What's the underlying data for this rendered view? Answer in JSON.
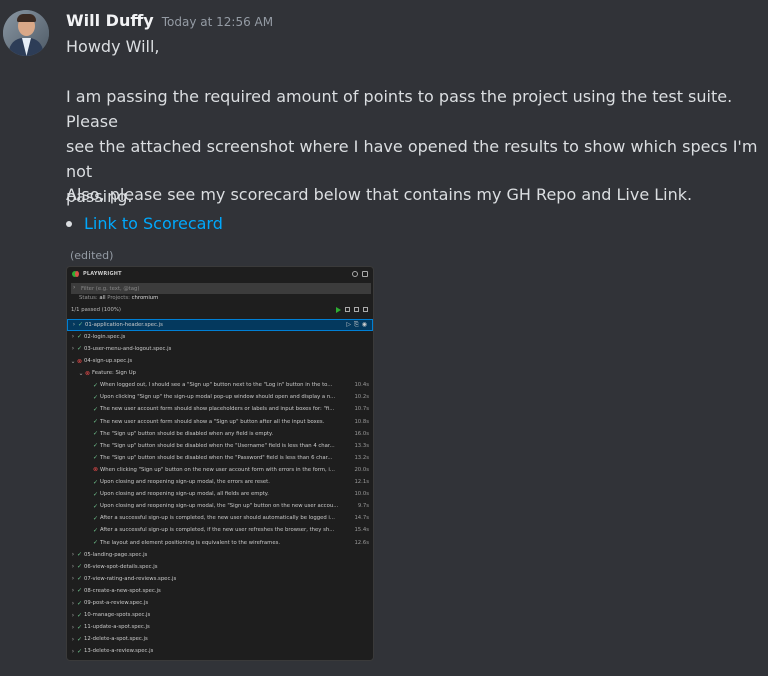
{
  "message": {
    "author": "Will Duffy",
    "timestamp": "Today at 12:56 AM",
    "greeting": "Howdy Will,",
    "paragraph1_line1": "I am passing the required amount of points to pass the project using  the test suite.  Please",
    "paragraph1_line2": "see the attached screenshot where I have opened the results to show which specs I'm not",
    "paragraph1_line3": "passing.",
    "paragraph2": "Also, please see my scorecard below that contains my GH Repo and Live Link.",
    "link_text": "Link to Scorecard",
    "edited_label": "(edited)"
  },
  "attachment": {
    "panel_title": "PLAYWRIGHT",
    "filter_placeholder": "Filter (e.g. text, @tag)",
    "status_label": "Status:",
    "status_value": "all",
    "projects_label": "Projects:",
    "projects_value": "chromium",
    "summary": "1/1 passed (100%)",
    "rows": [
      {
        "indent": 0,
        "chevron": ">",
        "status": "pass",
        "text": "01-application-header.spec.js",
        "duration": "",
        "selected": true
      },
      {
        "indent": 0,
        "chevron": ">",
        "status": "pass",
        "text": "02-login.spec.js",
        "duration": ""
      },
      {
        "indent": 0,
        "chevron": ">",
        "status": "pass",
        "text": "03-user-menu-and-logout.spec.js",
        "duration": ""
      },
      {
        "indent": 0,
        "chevron": "v",
        "status": "fail",
        "text": "04-sign-up.spec.js",
        "duration": ""
      },
      {
        "indent": 1,
        "chevron": "v",
        "status": "fail",
        "text": "Feature: Sign Up",
        "duration": ""
      },
      {
        "indent": 2,
        "chevron": "",
        "status": "pass",
        "text": "When logged out, I should see a \"Sign up\" button next to the \"Log in\" button in the to...",
        "duration": "10.4s"
      },
      {
        "indent": 2,
        "chevron": "",
        "status": "pass",
        "text": "Upon clicking \"Sign up\" the sign-up modal pop-up window should open and display a n...",
        "duration": "10.2s"
      },
      {
        "indent": 2,
        "chevron": "",
        "status": "pass",
        "text": "The new user account form should show placeholders or labels and input boxes for: \"fi...",
        "duration": "10.7s"
      },
      {
        "indent": 2,
        "chevron": "",
        "status": "pass",
        "text": "The new user account form should show a \"Sign up\" button after all the input boxes.",
        "duration": "10.8s"
      },
      {
        "indent": 2,
        "chevron": "",
        "status": "pass",
        "text": "The \"Sign up\" button should be disabled when any field is empty.",
        "duration": "16.0s"
      },
      {
        "indent": 2,
        "chevron": "",
        "status": "pass",
        "text": "The \"Sign up\" button should be disabled when the \"Username\" field is less than 4 char...",
        "duration": "13.3s"
      },
      {
        "indent": 2,
        "chevron": "",
        "status": "pass",
        "text": "The \"Sign up\" button should be disabled when the \"Password\" field is less than 6 char...",
        "duration": "13.2s"
      },
      {
        "indent": 2,
        "chevron": "",
        "status": "fail",
        "text": "When clicking \"Sign up\" button on the new user account form with errors in the form, i...",
        "duration": "20.0s"
      },
      {
        "indent": 2,
        "chevron": "",
        "status": "pass",
        "text": "Upon closing and reopening sign-up modal, the errors are reset.",
        "duration": "12.1s"
      },
      {
        "indent": 2,
        "chevron": "",
        "status": "pass",
        "text": "Upon closing and reopening sign-up modal, all fields are empty.",
        "duration": "10.0s"
      },
      {
        "indent": 2,
        "chevron": "",
        "status": "pass",
        "text": "Upon closing and reopening sign-up modal, the \"Sign up\" button on the new user accou...",
        "duration": "9.7s"
      },
      {
        "indent": 2,
        "chevron": "",
        "status": "pass",
        "text": "After a successful sign-up is completed, the new user should automatically be logged i...",
        "duration": "14.7s"
      },
      {
        "indent": 2,
        "chevron": "",
        "status": "pass",
        "text": "After a successful sign-up is completed, if the new user refreshes the browser, they sh...",
        "duration": "15.4s"
      },
      {
        "indent": 2,
        "chevron": "",
        "status": "pass",
        "text": "The layout and element positioning is equivalent to the wireframes.",
        "duration": "12.6s"
      },
      {
        "indent": 0,
        "chevron": ">",
        "status": "pass",
        "text": "05-landing-page.spec.js",
        "duration": ""
      },
      {
        "indent": 0,
        "chevron": ">",
        "status": "pass",
        "text": "06-view-spot-details.spec.js",
        "duration": ""
      },
      {
        "indent": 0,
        "chevron": ">",
        "status": "pass",
        "text": "07-view-rating-and-reviews.spec.js",
        "duration": ""
      },
      {
        "indent": 0,
        "chevron": ">",
        "status": "pass",
        "text": "08-create-a-new-spot.spec.js",
        "duration": ""
      },
      {
        "indent": 0,
        "chevron": ">",
        "status": "pass",
        "text": "09-post-a-review.spec.js",
        "duration": ""
      },
      {
        "indent": 0,
        "chevron": ">",
        "status": "pass",
        "text": "10-manage-spots.spec.js",
        "duration": ""
      },
      {
        "indent": 0,
        "chevron": ">",
        "status": "pass",
        "text": "11-update-a-spot.spec.js",
        "duration": ""
      },
      {
        "indent": 0,
        "chevron": ">",
        "status": "pass",
        "text": "12-delete-a-spot.spec.js",
        "duration": ""
      },
      {
        "indent": 0,
        "chevron": ">",
        "status": "pass",
        "text": "13-delete-a-review.spec.js",
        "duration": ""
      }
    ]
  }
}
